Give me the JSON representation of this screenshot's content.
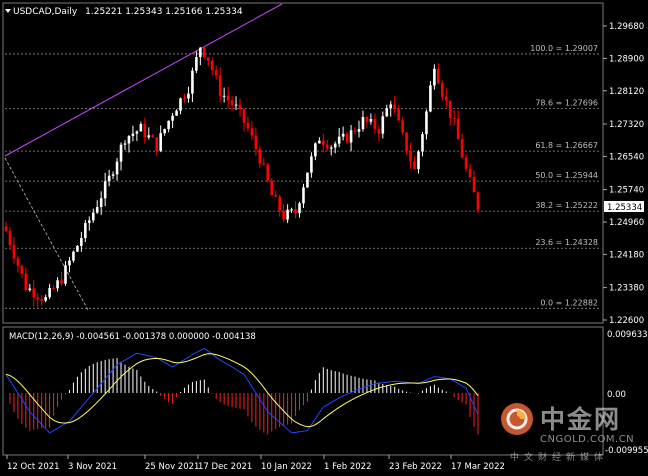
{
  "header": {
    "symbol": "USDCAD,Daily",
    "ohlc": "1.25221 1.25343 1.25166 1.25334"
  },
  "price_axis": {
    "ticks": [
      "1.29680",
      "1.28900",
      "1.28120",
      "1.27320",
      "1.26540",
      "1.25740",
      "1.24960",
      "1.24180",
      "1.23380",
      "1.22600"
    ],
    "current_label": "1.25334"
  },
  "fib_levels": [
    {
      "label": "100.0 = 1.29007",
      "price": 1.29007
    },
    {
      "label": "78.6 = 1.27696",
      "price": 1.27696
    },
    {
      "label": "61.8 = 1.26667",
      "price": 1.26667
    },
    {
      "label": "50.0 = 1.25944",
      "price": 1.25944
    },
    {
      "label": "38.2 = 1.25222",
      "price": 1.25222
    },
    {
      "label": "23.6 = 1.24328",
      "price": 1.24328
    },
    {
      "label": "0.0 = 1.22882",
      "price": 1.22882
    }
  ],
  "macd": {
    "label": "MACD(12,26,9) -0.004561 -0.001378 0.000000 -0.004138",
    "axis_top": "0.009633",
    "axis_zero": "0.00",
    "axis_bottom": "-0.009955"
  },
  "date_axis": [
    "12 Oct 2021",
    "3 Nov 2021",
    "25 Nov 2021",
    "17 Dec 2021",
    "10 Jan 2022",
    "1 Feb 2022",
    "23 Feb 2022",
    "17 Mar 2022"
  ],
  "watermark": {
    "brand_cn": "中金网",
    "brand_en": "CNGOLD.COM.CN",
    "sub_cn": "中文财经新媒体"
  },
  "colors": {
    "bull": "#ffffff",
    "bear": "#ff0000",
    "fib": "#8c8c8c",
    "trend": "#cc44ff",
    "macd_main": "#2244ff",
    "macd_signal": "#ffff66",
    "hist_pos": "#ffffff",
    "hist_neg": "#ff2020"
  }
}
